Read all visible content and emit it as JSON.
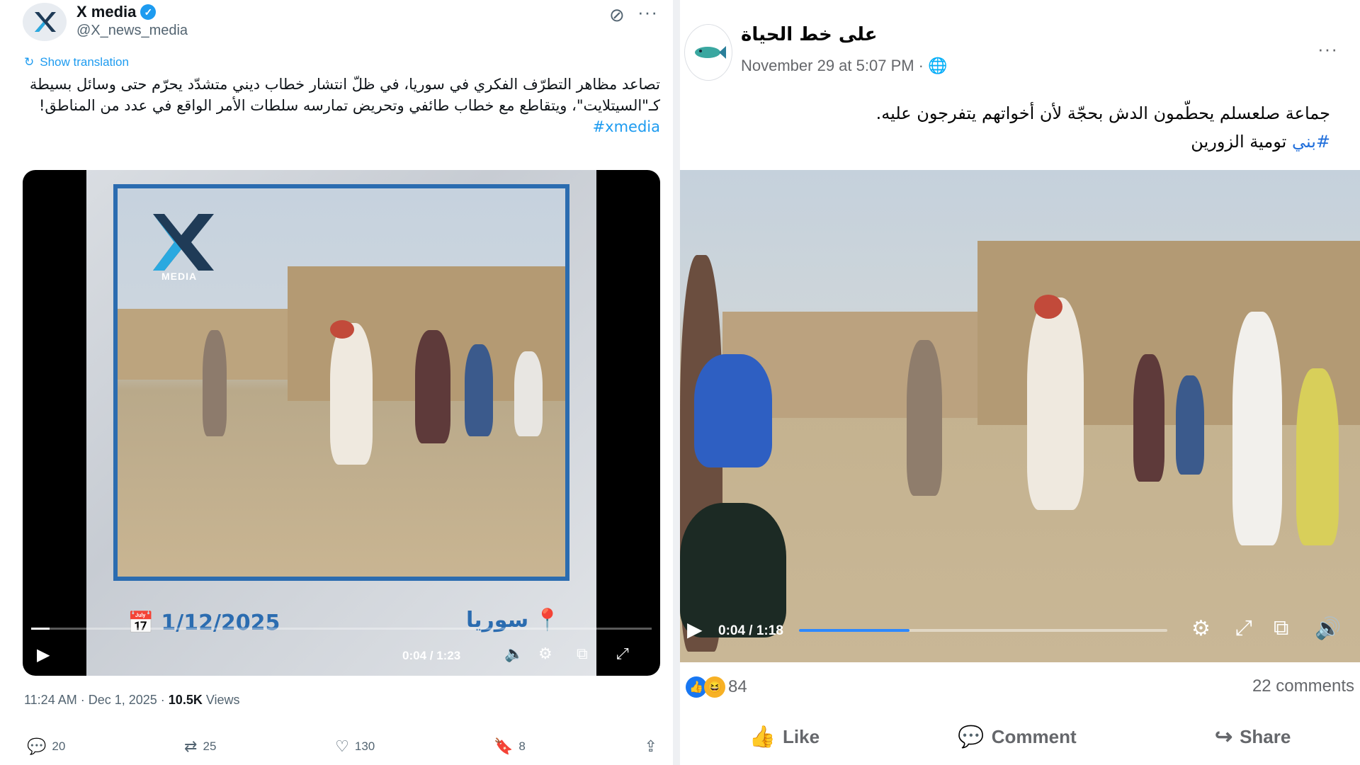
{
  "x_post": {
    "display_name": "X media",
    "handle": "@X_news_media",
    "show_translation": "Show translation",
    "text": "تصاعد مظاهر التطرّف الفكري في سوريا، في ظلّ انتشار خطاب ديني متشدّد يحرّم حتى وسائل بسيطة كـ\"السيتلايت\"، ويتقاطع مع خطاب طائفي وتحريض تمارسه سلطات الأمر الواقع في عدد من المناطق!",
    "hashtag": "#xmedia",
    "video": {
      "logo_text": "MEDIA",
      "date_label": "1/12/2025",
      "place_label": "سوريا",
      "time": "0:04 / 1:23",
      "progress": 0.03
    },
    "timestamp": "11:24 AM · Dec 1, 2025 ·",
    "views_count": "10.5K",
    "views_label": "Views",
    "replies": "20",
    "reposts": "25",
    "likes": "130",
    "bookmarks": "8"
  },
  "fb_post": {
    "page_name": "على خط الحياة",
    "time": "November 29 at 5:07 PM ·",
    "text": "جماعة صلعسلم يحطّمون الدش بحجّة لأن أخواتهم يتفرجون عليه.",
    "hashtag": "#بني",
    "text_tail": " تومية الزورين",
    "video": {
      "time": "0:04 / 1:18",
      "progress": 0.3
    },
    "reactions_count": "84",
    "comments_count": "22 comments",
    "like_label": "Like",
    "comment_label": "Comment",
    "share_label": "Share"
  },
  "colors": {
    "x_blue": "#1d9bf0",
    "fb_blue": "#216fdb",
    "video_frame_blue": "#2b6cb0"
  }
}
